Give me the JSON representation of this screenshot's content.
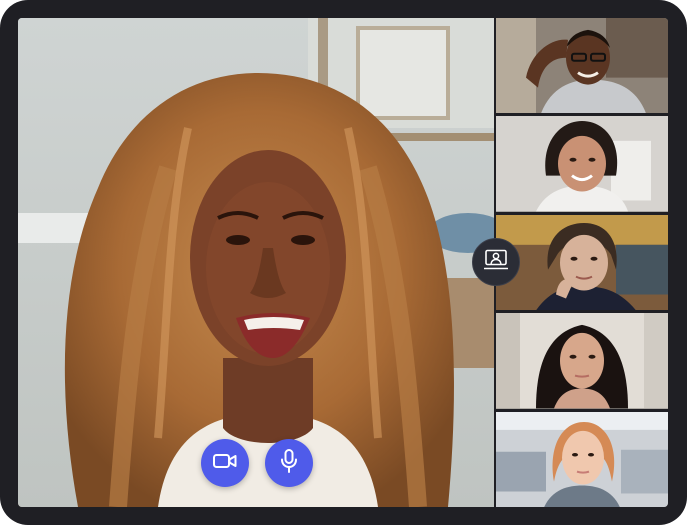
{
  "call": {
    "main_participant": {
      "name": ""
    },
    "thumbnails": [
      {
        "name": ""
      },
      {
        "name": ""
      },
      {
        "name": ""
      },
      {
        "name": ""
      },
      {
        "name": ""
      }
    ]
  },
  "controls": {
    "camera": {
      "icon": "video-camera-icon",
      "state": "on"
    },
    "mic": {
      "icon": "microphone-icon",
      "state": "on"
    },
    "share": {
      "icon": "screen-share-icon"
    }
  },
  "colors": {
    "frame": "#1f1f24",
    "control_accent": "#4f5bea",
    "share_button": "#2b2d36",
    "icon": "#ffffff"
  }
}
